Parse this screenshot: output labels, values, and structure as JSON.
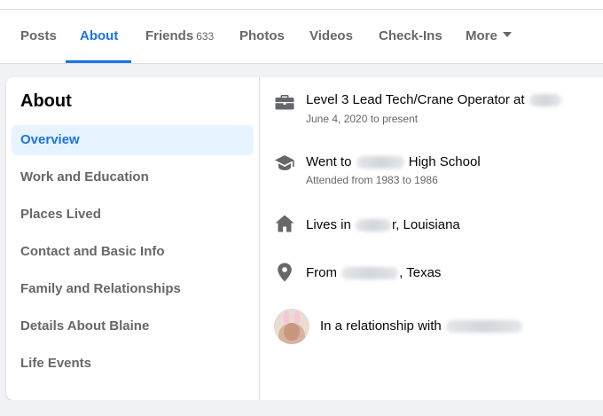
{
  "tabs": {
    "posts": "Posts",
    "about": "About",
    "friends": "Friends",
    "friends_count": "633",
    "photos": "Photos",
    "videos": "Videos",
    "checkins": "Check-Ins",
    "more": "More"
  },
  "sidebar": {
    "title": "About",
    "items": [
      {
        "label": "Overview",
        "active": true
      },
      {
        "label": "Work and Education"
      },
      {
        "label": "Places Lived"
      },
      {
        "label": "Contact and Basic Info"
      },
      {
        "label": "Family and Relationships"
      },
      {
        "label": "Details About Blaine"
      },
      {
        "label": "Life Events"
      }
    ]
  },
  "overview": {
    "work": {
      "prefix": "Level 3 Lead Tech/Crane Operator at",
      "dates": "June 4, 2020 to present",
      "icon": "briefcase-icon"
    },
    "education": {
      "prefix": "Went to",
      "suffix": "High School",
      "dates": "Attended from 1983 to 1986",
      "icon": "graduation-cap-icon"
    },
    "lives": {
      "prefix": "Lives in",
      "suffix": "r, Louisiana",
      "icon": "home-icon"
    },
    "from": {
      "prefix": "From",
      "suffix": ", Texas",
      "icon": "location-pin-icon"
    },
    "relationship": {
      "prefix": "In a relationship with"
    }
  },
  "colors": {
    "accent": "#1b74e4",
    "active_bg": "#e7f3ff",
    "muted_text": "#65676b",
    "icon": "#65676b",
    "page_bg": "#f0f2f5"
  }
}
